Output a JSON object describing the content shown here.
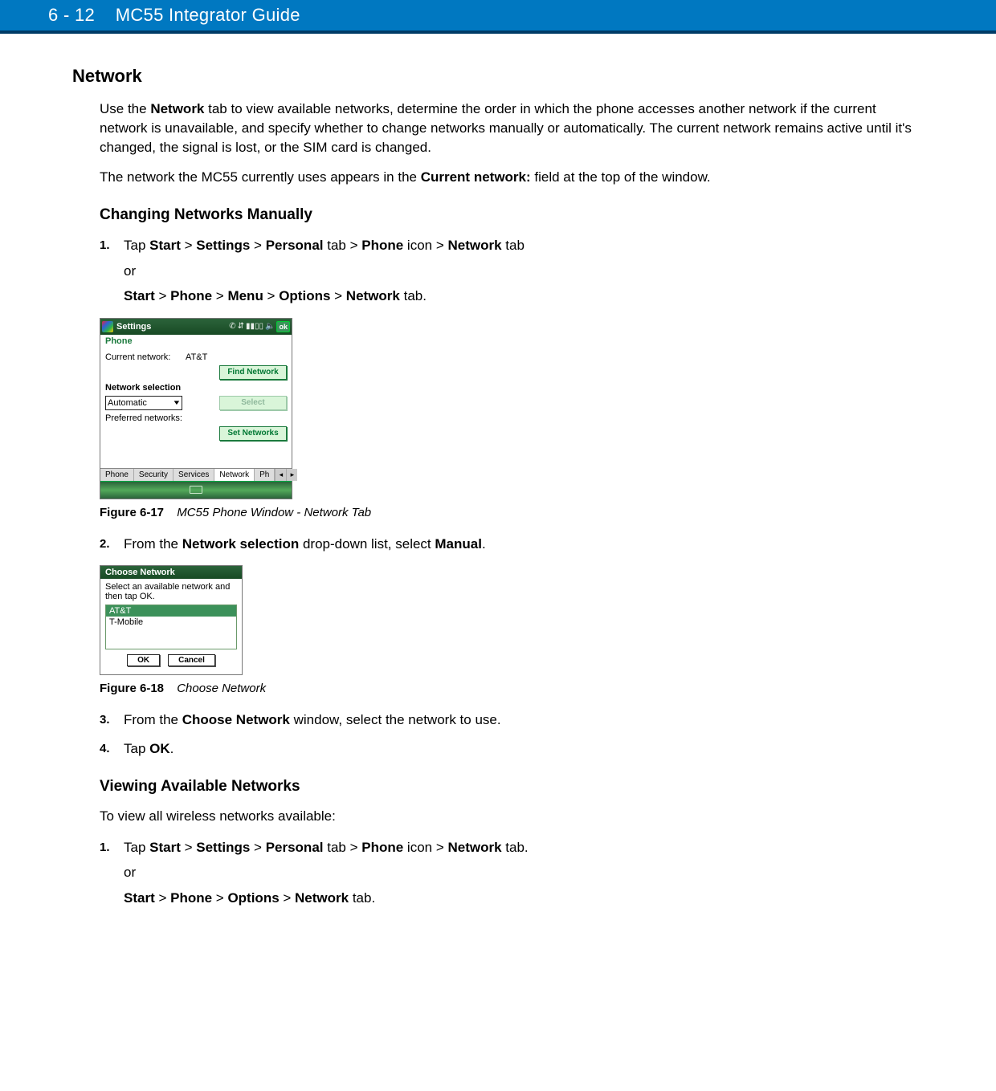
{
  "header": {
    "page": "6 - 12",
    "title": "MC55 Integrator Guide"
  },
  "section": {
    "title": "Network"
  },
  "para1_a": "Use the ",
  "para1_bold": "Network",
  "para1_b": " tab to view available networks, determine the order in which the phone accesses another network if the current network is unavailable, and specify whether to change networks manually or automatically. The current network remains active until it's changed, the signal is lost, or the SIM card is changed.",
  "para2_a": "The network the MC55 currently uses appears in the ",
  "para2_bold": "Current network:",
  "para2_b": " field at the top of the window.",
  "sub1": "Changing Networks Manually",
  "step1": {
    "num": "1.",
    "t0": "Tap ",
    "b0": "Start",
    "g0": " > ",
    "b1": "Settings",
    "g1": " > ",
    "b2": "Personal",
    "t2": " tab > ",
    "b3": "Phone",
    "t3": " icon > ",
    "b4": "Network",
    "t4": " tab",
    "or": "or",
    "alt_b0": "Start",
    "alt_g0": " > ",
    "alt_b1": "Phone",
    "alt_g1": " > ",
    "alt_b2": "Menu",
    "alt_g2": " > ",
    "alt_b3": "Options",
    "alt_g3": " > ",
    "alt_b4": "Network",
    "alt_t4": " tab."
  },
  "wm": {
    "title": "Settings",
    "ok": "ok",
    "sub": "Phone",
    "currentLabel": "Current network:",
    "currentValue": "AT&T",
    "findBtn": "Find Network",
    "netSelLabel": "Network selection",
    "netSelValue": "Automatic",
    "selectBtn": "Select",
    "prefLabel": "Preferred networks:",
    "setBtn": "Set Networks",
    "tabs": [
      "Phone",
      "Security",
      "Services",
      "Network",
      "Ph"
    ]
  },
  "fig1": {
    "label": "Figure 6-17",
    "title": "MC55 Phone Window - Network Tab"
  },
  "step2": {
    "num": "2.",
    "a": "From the ",
    "b1": "Network selection",
    "mid": " drop-down list, select ",
    "b2": "Manual",
    "end": "."
  },
  "dlg": {
    "title": "Choose Network",
    "msg": "Select an available network and then tap OK.",
    "items": [
      "AT&T",
      "T-Mobile"
    ],
    "ok": "OK",
    "cancel": "Cancel"
  },
  "fig2": {
    "label": "Figure 6-18",
    "title": "Choose Network"
  },
  "step3": {
    "num": "3.",
    "a": "From the ",
    "b": "Choose Network",
    "c": " window, select the network to use."
  },
  "step4": {
    "num": "4.",
    "a": "Tap ",
    "b": "OK",
    "c": "."
  },
  "sub2": "Viewing Available Networks",
  "para3": "To view all wireless networks available:",
  "vstep1": {
    "num": "1.",
    "t0": "Tap ",
    "b0": "Start",
    "g0": " > ",
    "b1": "Settings",
    "g1": " > ",
    "b2": "Personal",
    "t2": " tab > ",
    "b3": "Phone",
    "t3": " icon > ",
    "b4": "Network",
    "t4": " tab.",
    "or": "or",
    "alt_b0": "Start",
    "alt_g0": " > ",
    "alt_b1": "Phone",
    "alt_g1": " > ",
    "alt_b2": "Options",
    "alt_g2": " > ",
    "alt_b3": "Network",
    "alt_t3": " tab."
  }
}
